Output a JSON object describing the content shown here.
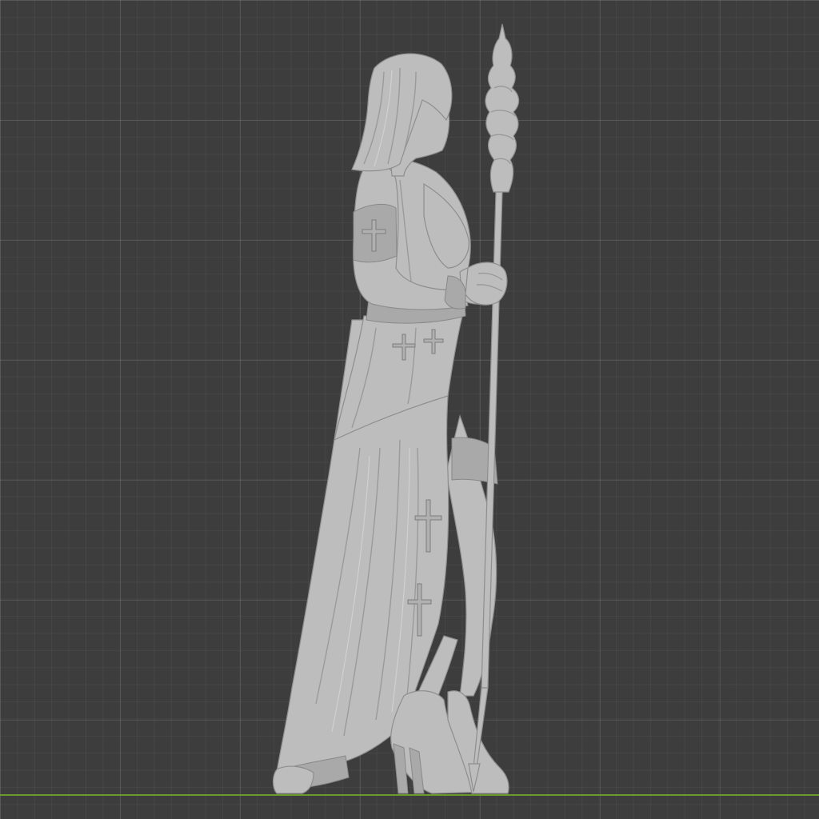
{
  "viewport": {
    "background_color": "#3d3d3d",
    "grid_major_color": "#575757",
    "grid_minor_color": "#464646",
    "ground_axis_color": "#6a9a2e"
  },
  "model": {
    "material_color": "#bdbdbd",
    "shading": "solid"
  }
}
